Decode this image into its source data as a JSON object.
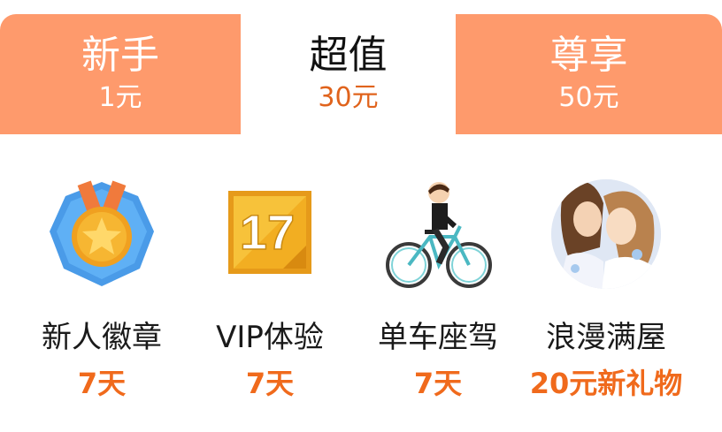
{
  "tabs": [
    {
      "name": "新手",
      "price": "1元",
      "active": false
    },
    {
      "name": "超值",
      "price": "30元",
      "active": true
    },
    {
      "name": "尊享",
      "price": "50元",
      "active": false
    }
  ],
  "perks": [
    {
      "title": "新人徽章",
      "value": "7天",
      "icon": "medal-badge-icon"
    },
    {
      "title": "VIP体验",
      "value": "7天",
      "icon": "vip-tag-icon"
    },
    {
      "title": "单车座驾",
      "value": "7天",
      "icon": "bicycle-rider-icon"
    },
    {
      "title": "浪漫满屋",
      "value": "20元新礼物",
      "icon": "romantic-couple-icon"
    }
  ],
  "vip_badge_number": "17",
  "colors": {
    "tab_inactive_bg": "#fe9a6c",
    "accent_orange": "#e0631c",
    "value_orange": "#f06a1c"
  }
}
